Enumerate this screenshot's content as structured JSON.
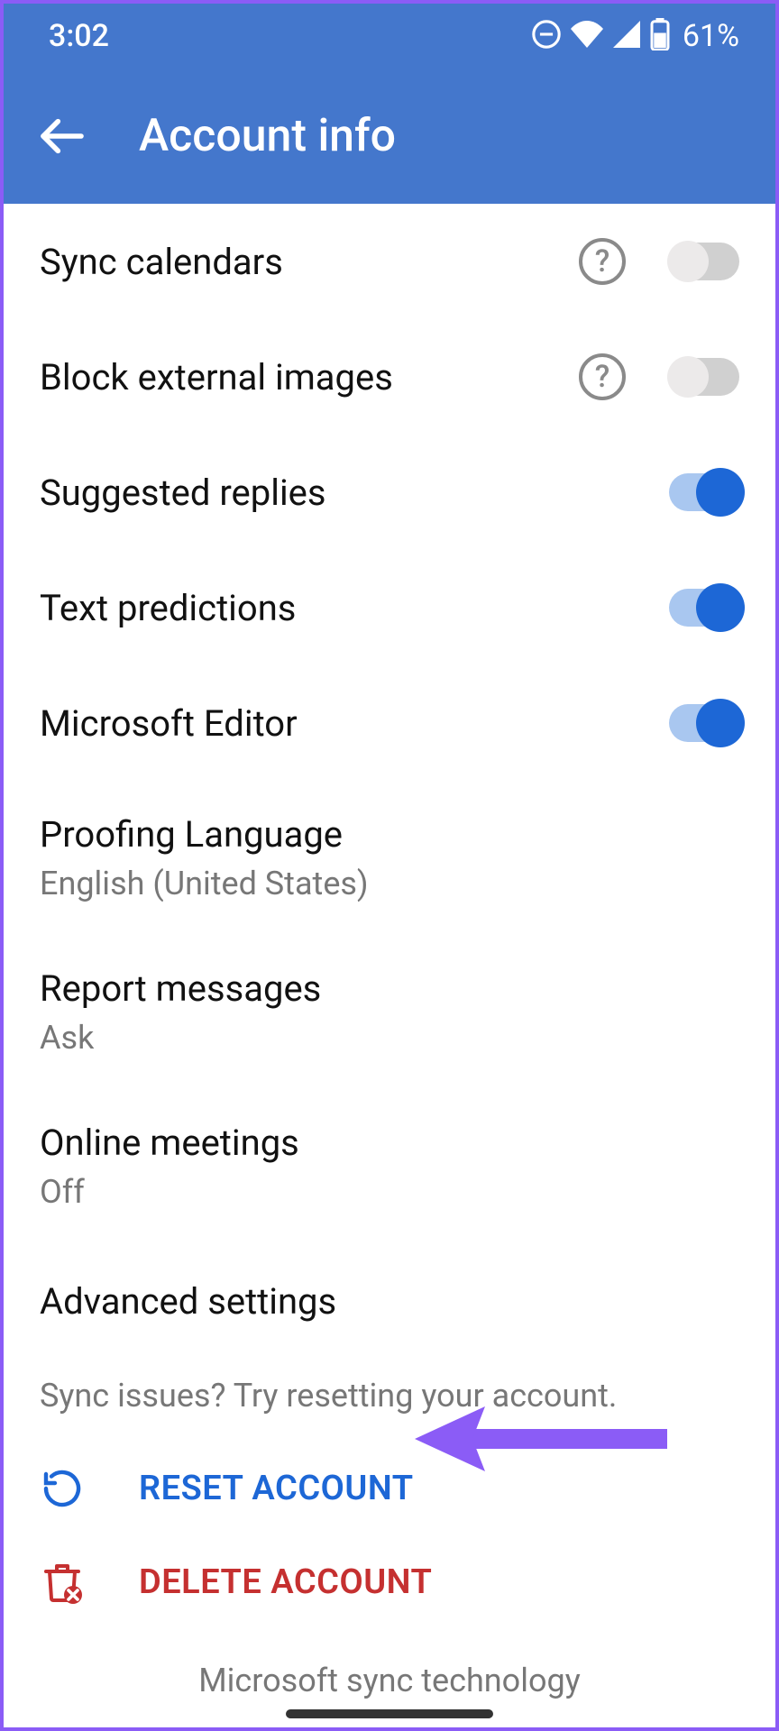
{
  "status": {
    "time": "3:02",
    "battery_pct": "61%"
  },
  "header": {
    "title": "Account info"
  },
  "settings": {
    "sync_calendars": {
      "label": "Sync calendars",
      "on": false,
      "help": true
    },
    "block_external": {
      "label": "Block external images",
      "on": false,
      "help": true
    },
    "suggested_replies": {
      "label": "Suggested replies",
      "on": true
    },
    "text_predictions": {
      "label": "Text predictions",
      "on": true
    },
    "microsoft_editor": {
      "label": "Microsoft Editor",
      "on": true
    },
    "proofing": {
      "label": "Proofing Language",
      "value": "English (United States)"
    },
    "report_messages": {
      "label": "Report messages",
      "value": "Ask"
    },
    "online_meetings": {
      "label": "Online meetings",
      "value": "Off"
    },
    "advanced": {
      "label": "Advanced settings"
    }
  },
  "hint": "Sync issues? Try resetting your account.",
  "actions": {
    "reset": "RESET ACCOUNT",
    "delete": "DELETE ACCOUNT"
  },
  "footer": "Microsoft sync technology",
  "colors": {
    "primary": "#4477cc",
    "accent": "#1d67d6",
    "danger": "#c53030",
    "annotation": "#8b5cf6"
  }
}
